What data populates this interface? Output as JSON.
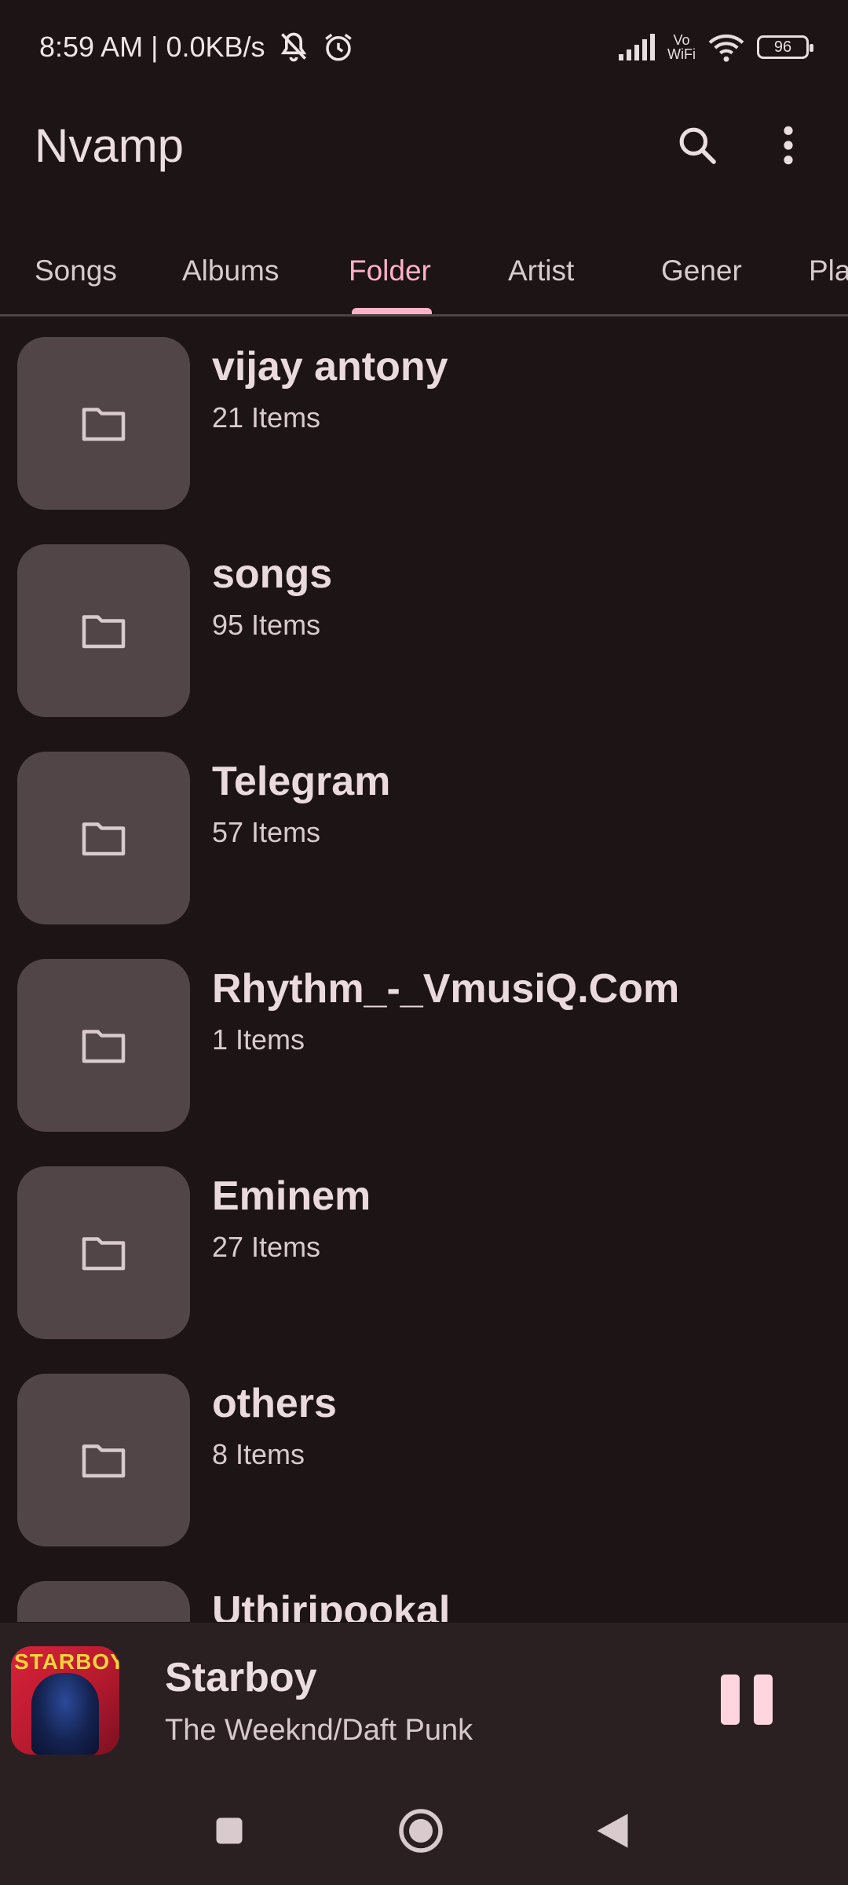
{
  "status_bar": {
    "time_speed": "8:59 AM | 0.0KB/s",
    "vowifi_line1": "Vo",
    "vowifi_line2": "WiFi",
    "battery": "96"
  },
  "appbar": {
    "title": "Nvamp",
    "search_icon": "search-icon",
    "menu_icon": "more-vert-icon"
  },
  "tabs": [
    {
      "label": "Songs"
    },
    {
      "label": "Albums"
    },
    {
      "label": "Folder",
      "active": true
    },
    {
      "label": "Artist"
    },
    {
      "label": "Gener"
    },
    {
      "label": "Pla"
    }
  ],
  "folders": [
    {
      "name": "vijay antony",
      "count": "21 Items"
    },
    {
      "name": "songs",
      "count": "95 Items"
    },
    {
      "name": "Telegram",
      "count": "57 Items"
    },
    {
      "name": "Rhythm_-_VmusiQ.Com",
      "count": "1 Items"
    },
    {
      "name": "Eminem",
      "count": "27 Items"
    },
    {
      "name": "others",
      "count": "8 Items"
    },
    {
      "name": "Uthiripookal",
      "count": ""
    }
  ],
  "player": {
    "title": "Starboy",
    "artist": "The Weeknd/Daft Punk",
    "art_text": "STARBOY",
    "state_icon": "pause-icon"
  },
  "navbar": {
    "icons": [
      "recents-icon",
      "home-icon",
      "back-icon"
    ]
  },
  "colors": {
    "background": "#1c1415",
    "accent": "#ffb1c8",
    "folder_tile": "#524547",
    "player_bg": "#2a2022"
  }
}
